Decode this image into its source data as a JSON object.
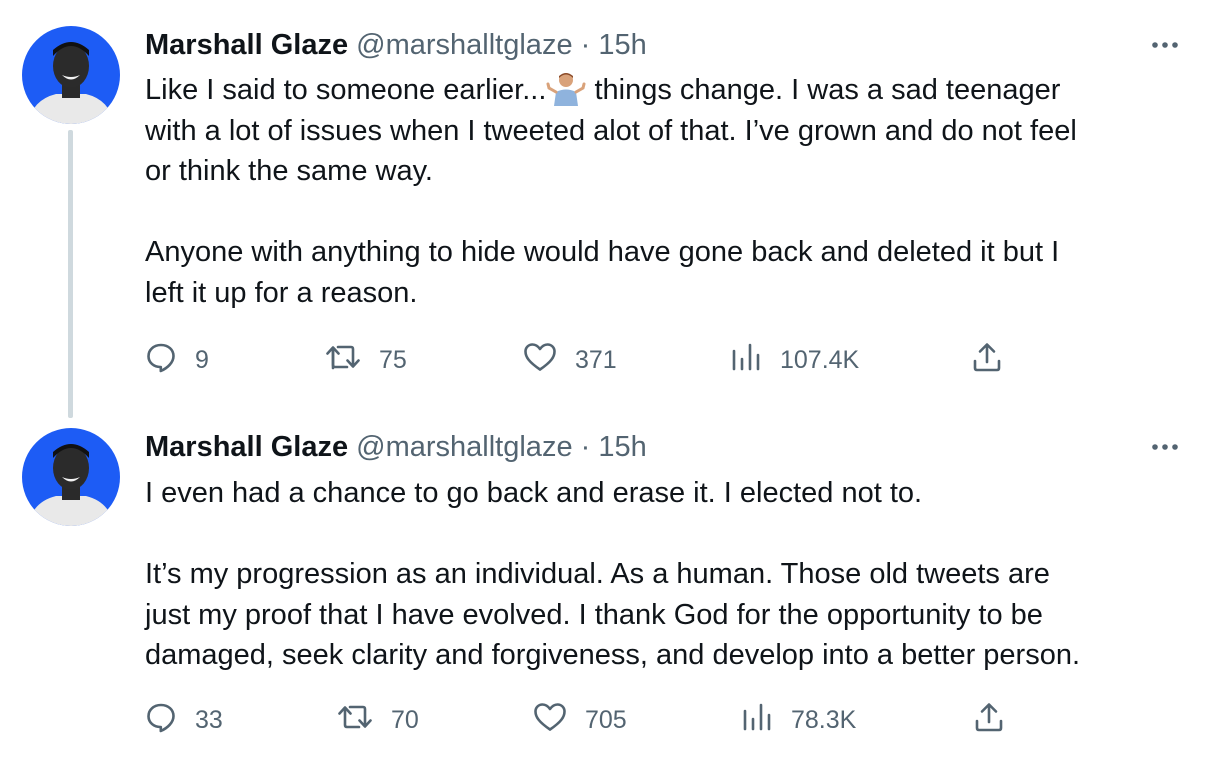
{
  "tweets": [
    {
      "author": {
        "name": "Marshall Glaze",
        "handle": "@marshalltglaze"
      },
      "separator": "·",
      "time": "15h",
      "lines": [
        [
          "Like I said to someone earlier...",
          " things change. I was a sad teenager"
        ],
        "with a lot of issues when I tweeted alot of that. I’ve grown and do not feel",
        "or think the same way."
      ],
      "paragraph2": [
        "Anyone with anything to hide would have gone back and deleted it but I",
        "left it up for a reason."
      ],
      "emoji": "person-shrugging-emoji",
      "stats": {
        "replies": "9",
        "retweets": "75",
        "likes": "371",
        "views": "107.4K"
      }
    },
    {
      "author": {
        "name": "Marshall Glaze",
        "handle": "@marshalltglaze"
      },
      "separator": "·",
      "time": "15h",
      "paragraph1": [
        "I even had a chance to go back and erase it. I elected not to."
      ],
      "paragraph2": [
        "It’s my progression as an individual. As a human. Those old tweets are",
        "just my proof that I have evolved. I thank God for the opportunity to be",
        "damaged, seek clarity and forgiveness, and develop into a better person."
      ],
      "stats": {
        "replies": "33",
        "retweets": "70",
        "likes": "705",
        "views": "78.3K"
      }
    }
  ],
  "colors": {
    "text": "#0f1419",
    "secondary": "#536471",
    "thread_line": "#cfd9de",
    "avatar_bg": "#1d5cf5"
  }
}
